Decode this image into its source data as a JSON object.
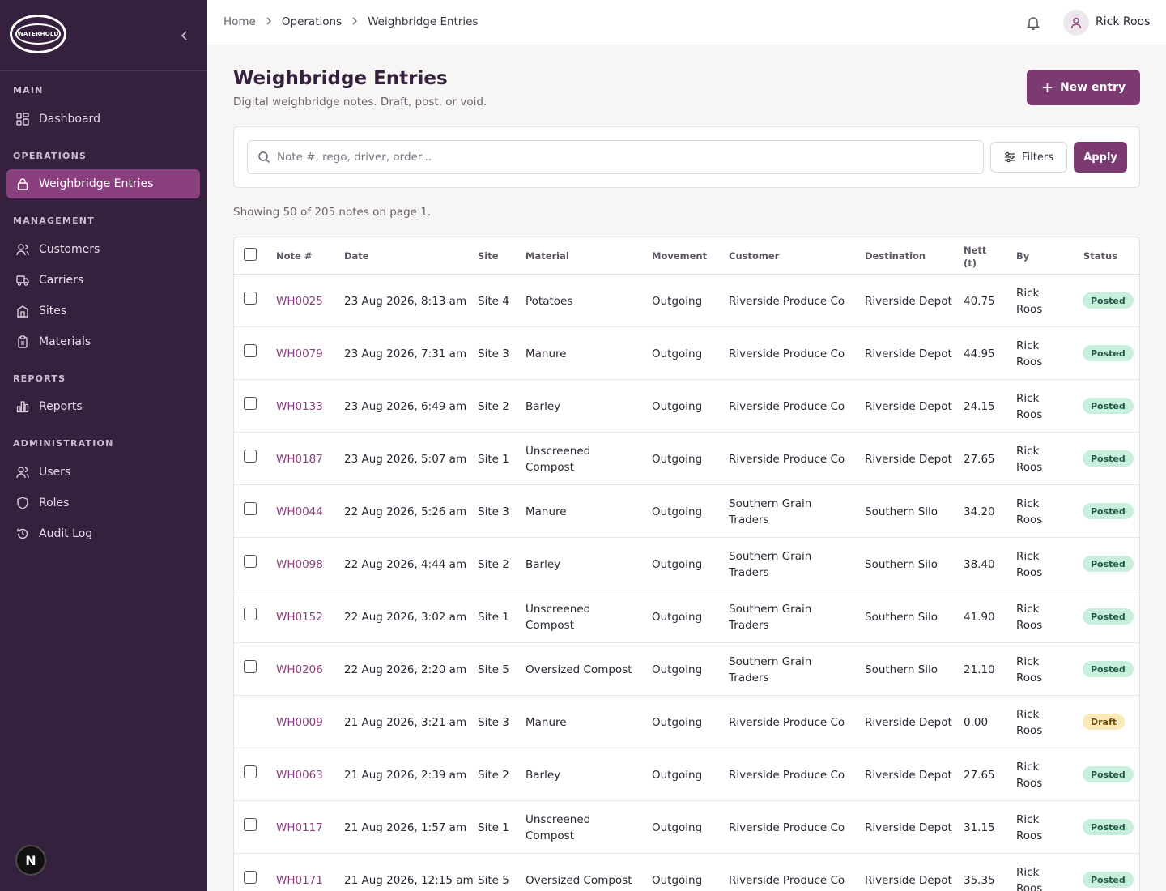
{
  "brand": {
    "logo_text": "WATERHOLD"
  },
  "sidebar": {
    "sections": [
      {
        "title": "MAIN",
        "items": [
          {
            "label": "Dashboard",
            "icon": "dashboard-icon"
          }
        ]
      },
      {
        "title": "OPERATIONS",
        "items": [
          {
            "label": "Weighbridge Entries",
            "icon": "lock-icon",
            "active": true
          }
        ]
      },
      {
        "title": "MANAGEMENT",
        "items": [
          {
            "label": "Customers",
            "icon": "users-icon"
          },
          {
            "label": "Carriers",
            "icon": "truck-icon"
          },
          {
            "label": "Sites",
            "icon": "building-icon"
          },
          {
            "label": "Materials",
            "icon": "clipboard-icon"
          }
        ]
      },
      {
        "title": "REPORTS",
        "items": [
          {
            "label": "Reports",
            "icon": "bar-chart-icon"
          }
        ]
      },
      {
        "title": "ADMINISTRATION",
        "items": [
          {
            "label": "Users",
            "icon": "users-icon"
          },
          {
            "label": "Roles",
            "icon": "shield-icon"
          },
          {
            "label": "Audit Log",
            "icon": "history-icon"
          }
        ]
      }
    ],
    "bottom_badge": "N"
  },
  "topbar": {
    "breadcrumb": [
      "Home",
      "Operations",
      "Weighbridge Entries"
    ],
    "user_name": "Rick Roos"
  },
  "page": {
    "title": "Weighbridge Entries",
    "subtitle": "Digital weighbridge notes. Draft, post, or void.",
    "new_button": "New entry",
    "search_placeholder": "Note #, rego, driver, order...",
    "filters_label": "Filters",
    "apply_label": "Apply",
    "showing_text": "Showing 50 of 205 notes on page 1."
  },
  "table": {
    "columns": [
      "Note #",
      "Date",
      "Site",
      "Material",
      "Movement",
      "Customer",
      "Destination",
      "Nett (t)",
      "By",
      "Status"
    ],
    "rows": [
      {
        "note": "WH0025",
        "date": "23 Aug 2026, 8:13 am",
        "site": "Site 4",
        "material": "Potatoes",
        "movement": "Outgoing",
        "customer": "Riverside Produce Co",
        "destination": "Riverside Depot",
        "nett": "40.75",
        "by": "Rick Roos",
        "status": "Posted",
        "checkbox": true
      },
      {
        "note": "WH0079",
        "date": "23 Aug 2026, 7:31 am",
        "site": "Site 3",
        "material": "Manure",
        "movement": "Outgoing",
        "customer": "Riverside Produce Co",
        "destination": "Riverside Depot",
        "nett": "44.95",
        "by": "Rick Roos",
        "status": "Posted",
        "checkbox": true
      },
      {
        "note": "WH0133",
        "date": "23 Aug 2026, 6:49 am",
        "site": "Site 2",
        "material": "Barley",
        "movement": "Outgoing",
        "customer": "Riverside Produce Co",
        "destination": "Riverside Depot",
        "nett": "24.15",
        "by": "Rick Roos",
        "status": "Posted",
        "checkbox": true
      },
      {
        "note": "WH0187",
        "date": "23 Aug 2026, 5:07 am",
        "site": "Site 1",
        "material": "Unscreened Compost",
        "movement": "Outgoing",
        "customer": "Riverside Produce Co",
        "destination": "Riverside Depot",
        "nett": "27.65",
        "by": "Rick Roos",
        "status": "Posted",
        "checkbox": true
      },
      {
        "note": "WH0044",
        "date": "22 Aug 2026, 5:26 am",
        "site": "Site 3",
        "material": "Manure",
        "movement": "Outgoing",
        "customer": "Southern Grain Traders",
        "destination": "Southern Silo",
        "nett": "34.20",
        "by": "Rick Roos",
        "status": "Posted",
        "checkbox": true
      },
      {
        "note": "WH0098",
        "date": "22 Aug 2026, 4:44 am",
        "site": "Site 2",
        "material": "Barley",
        "movement": "Outgoing",
        "customer": "Southern Grain Traders",
        "destination": "Southern Silo",
        "nett": "38.40",
        "by": "Rick Roos",
        "status": "Posted",
        "checkbox": true
      },
      {
        "note": "WH0152",
        "date": "22 Aug 2026, 3:02 am",
        "site": "Site 1",
        "material": "Unscreened Compost",
        "movement": "Outgoing",
        "customer": "Southern Grain Traders",
        "destination": "Southern Silo",
        "nett": "41.90",
        "by": "Rick Roos",
        "status": "Posted",
        "checkbox": true
      },
      {
        "note": "WH0206",
        "date": "22 Aug 2026, 2:20 am",
        "site": "Site 5",
        "material": "Oversized Compost",
        "movement": "Outgoing",
        "customer": "Southern Grain Traders",
        "destination": "Southern Silo",
        "nett": "21.10",
        "by": "Rick Roos",
        "status": "Posted",
        "checkbox": true
      },
      {
        "note": "WH0009",
        "date": "21 Aug 2026, 3:21 am",
        "site": "Site 3",
        "material": "Manure",
        "movement": "Outgoing",
        "customer": "Riverside Produce Co",
        "destination": "Riverside Depot",
        "nett": "0.00",
        "by": "Rick Roos",
        "status": "Draft",
        "checkbox": false
      },
      {
        "note": "WH0063",
        "date": "21 Aug 2026, 2:39 am",
        "site": "Site 2",
        "material": "Barley",
        "movement": "Outgoing",
        "customer": "Riverside Produce Co",
        "destination": "Riverside Depot",
        "nett": "27.65",
        "by": "Rick Roos",
        "status": "Posted",
        "checkbox": true
      },
      {
        "note": "WH0117",
        "date": "21 Aug 2026, 1:57 am",
        "site": "Site 1",
        "material": "Unscreened Compost",
        "movement": "Outgoing",
        "customer": "Riverside Produce Co",
        "destination": "Riverside Depot",
        "nett": "31.15",
        "by": "Rick Roos",
        "status": "Posted",
        "checkbox": true
      },
      {
        "note": "WH0171",
        "date": "21 Aug 2026, 12:15 am",
        "site": "Site 5",
        "material": "Oversized Compost",
        "movement": "Outgoing",
        "customer": "Riverside Produce Co",
        "destination": "Riverside Depot",
        "nett": "35.35",
        "by": "Rick Roos",
        "status": "Posted",
        "checkbox": true
      }
    ]
  },
  "colors": {
    "sidebar_bg": "#35203d",
    "accent": "#7b3a70",
    "posted_bg": "#c8eedc",
    "draft_bg": "#fbeab7"
  }
}
